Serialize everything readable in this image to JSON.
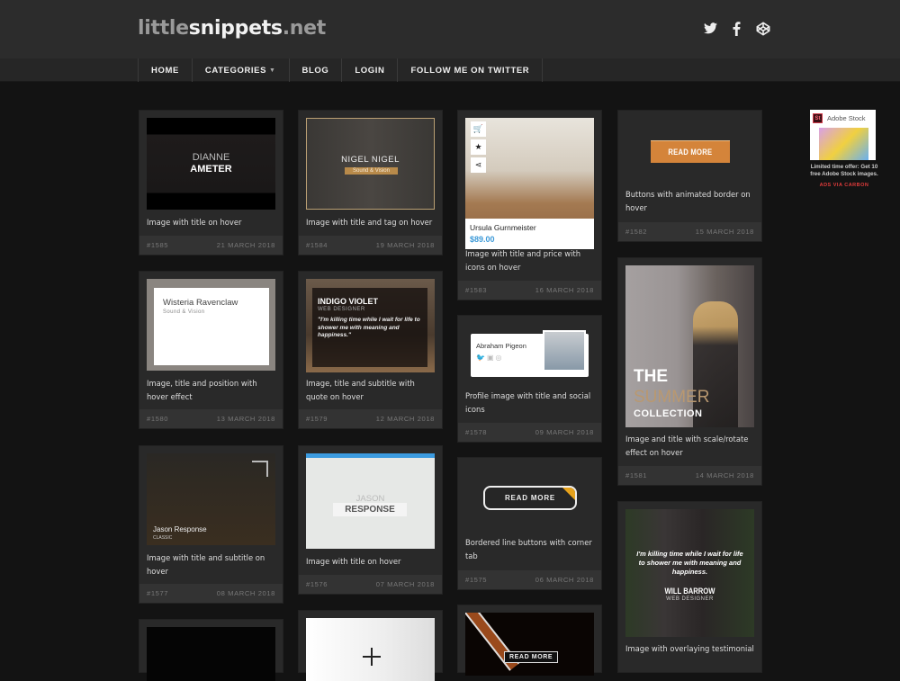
{
  "site": {
    "logo_part1": "little",
    "logo_part2": "snippets",
    "logo_part3": ".net"
  },
  "social": [
    {
      "icon": "twitter-icon"
    },
    {
      "icon": "facebook-icon"
    },
    {
      "icon": "codepen-icon"
    }
  ],
  "nav": {
    "items": [
      {
        "label": "HOME"
      },
      {
        "label": "CATEGORIES",
        "caret": "▼"
      },
      {
        "label": "BLOG"
      },
      {
        "label": "LOGIN"
      },
      {
        "label": "FOLLOW ME ON TWITTER"
      }
    ]
  },
  "cards": [
    {
      "id": "#1585",
      "date": "21 MARCH 2018",
      "desc": "Image with title on hover",
      "preview": {
        "line1": "DIANNE",
        "line2": "AMETER"
      }
    },
    {
      "id": "#1584",
      "date": "19 MARCH 2018",
      "desc": "Image with title and tag on hover",
      "preview": {
        "title": "NIGEL NIGEL",
        "tag": "Sound & Vision"
      }
    },
    {
      "id": "#1583",
      "date": "16 MARCH 2018",
      "desc": "Image with title and price with icons on hover",
      "preview": {
        "title": "Ursula Gurnmeister",
        "price": "$89.00"
      }
    },
    {
      "id": "#1582",
      "date": "15 MARCH 2018",
      "desc": "Buttons with animated border on hover",
      "preview": {
        "button": "READ MORE"
      }
    },
    {
      "id": "#1580",
      "date": "13 MARCH 2018",
      "desc": "Image, title and position with hover effect",
      "preview": {
        "title": "Wisteria Ravenclaw",
        "subtitle": "Sound & Vision"
      }
    },
    {
      "id": "#1579",
      "date": "12 MARCH 2018",
      "desc": "Image, title and subtitle with quote on hover",
      "preview": {
        "title": "INDIGO VIOLET",
        "subtitle": "WEB DESIGNER",
        "quote": "\"I'm killing time while I wait for life to shower me with meaning and happiness.\""
      }
    },
    {
      "id": "#1578",
      "date": "09 MARCH 2018",
      "desc": "Profile image with title and social icons",
      "preview": {
        "title": "Abraham Pigeon"
      }
    },
    {
      "id": "#1581",
      "date": "14 MARCH 2018",
      "desc": "Image and title with scale/rotate effect on hover",
      "preview": {
        "line1": "THE",
        "line2": "SUMMER",
        "line3": "COLLECTION"
      }
    },
    {
      "id": "#1577",
      "date": "08 MARCH 2018",
      "desc": "Image with title and subtitle on hover",
      "preview": {
        "title": "Jason Response",
        "subtitle": "CLASSIC"
      }
    },
    {
      "id": "#1576",
      "date": "07 MARCH 2018",
      "desc": "Image with title on hover",
      "preview": {
        "line1": "JASON",
        "line2": "RESPONSE"
      }
    },
    {
      "id": "#1575",
      "date": "06 MARCH 2018",
      "desc": "Bordered line buttons with corner tab",
      "preview": {
        "button": "READ MORE"
      }
    },
    {
      "id": "",
      "date": "",
      "desc": "Image with overlaying testimonial",
      "preview": {
        "quote": "I'm killing time while I wait for life to shower me with meaning and happiness.",
        "name": "WILL BARROW",
        "role": "WEB DESIGNER"
      }
    },
    {
      "id": "",
      "date": "",
      "desc": "",
      "preview": {
        "button": "READ MORE"
      }
    }
  ],
  "ad": {
    "brand": "Adobe Stock",
    "brand_badge": "St",
    "text": "Limited time offer: Get 10 free Adobe Stock images.",
    "via": "ADS VIA CARBON"
  },
  "colors": {
    "accent_orange": "#d4843a",
    "price_blue": "#3d9ad8",
    "bg": "#131313",
    "card": "#292929"
  }
}
